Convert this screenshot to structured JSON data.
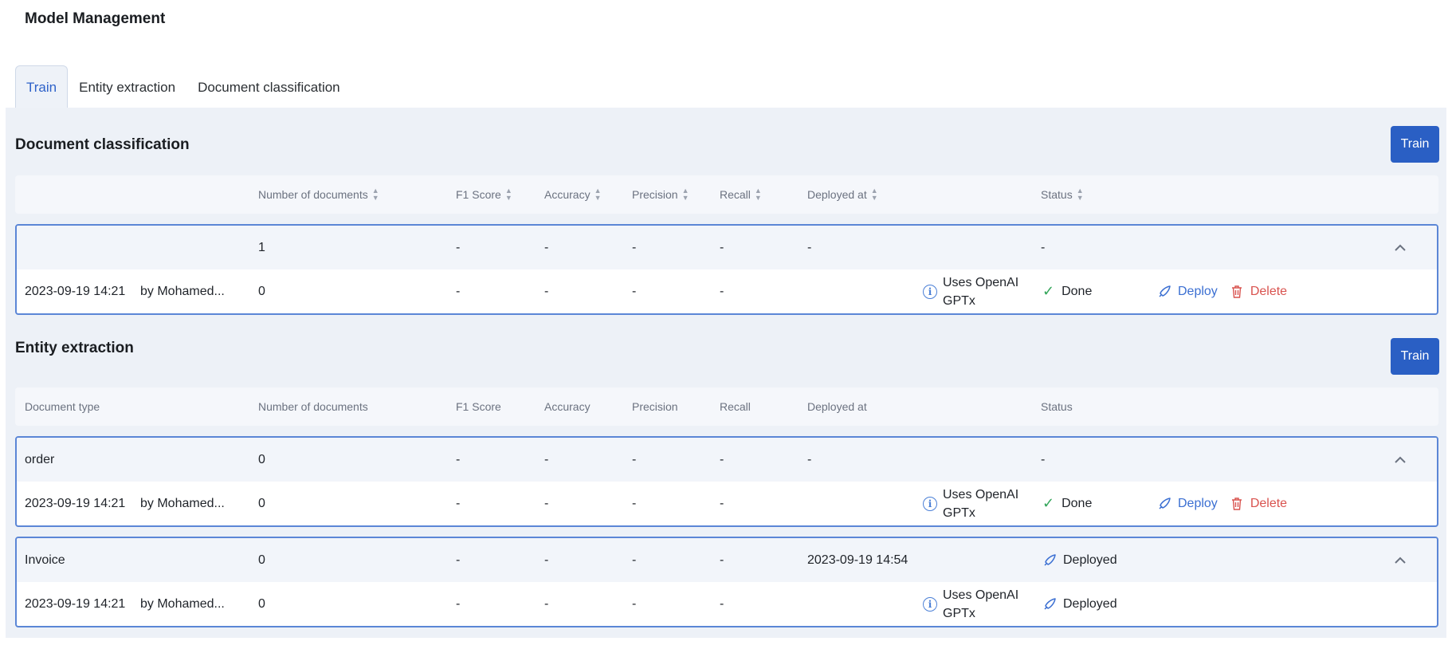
{
  "page": {
    "title": "Model Management"
  },
  "tabs": [
    {
      "label": "Train",
      "active": true
    },
    {
      "label": "Entity extraction",
      "active": false
    },
    {
      "label": "Document classification",
      "active": false
    }
  ],
  "doc_class": {
    "title": "Document classification",
    "train_label": "Train",
    "headers": {
      "doc_type": "",
      "num_docs": "Number of documents",
      "f1": "F1 Score",
      "accuracy": "Accuracy",
      "precision": "Precision",
      "recall": "Recall",
      "deployed_at": "Deployed at",
      "status": "Status"
    },
    "groups": [
      {
        "summary": {
          "doc_type": "",
          "num_docs": "1",
          "f1": "-",
          "accuracy": "-",
          "precision": "-",
          "recall": "-",
          "deployed_at": "-",
          "status": "-"
        },
        "version": {
          "date": "2023-09-19 14:21",
          "by": "by Mohamed...",
          "num_docs": "0",
          "f1": "-",
          "accuracy": "-",
          "precision": "-",
          "recall": "-",
          "info_line1": "Uses OpenAI",
          "info_line2": "GPTx",
          "status": "Done",
          "deploy_label": "Deploy",
          "delete_label": "Delete"
        }
      }
    ]
  },
  "entity": {
    "title": "Entity extraction",
    "train_label": "Train",
    "headers": {
      "doc_type": "Document type",
      "num_docs": "Number of documents",
      "f1": "F1 Score",
      "accuracy": "Accuracy",
      "precision": "Precision",
      "recall": "Recall",
      "deployed_at": "Deployed at",
      "status": "Status"
    },
    "groups": [
      {
        "summary": {
          "doc_type": "order",
          "num_docs": "0",
          "f1": "-",
          "accuracy": "-",
          "precision": "-",
          "recall": "-",
          "deployed_at": "-",
          "status": "-"
        },
        "version": {
          "date": "2023-09-19 14:21",
          "by": "by Mohamed...",
          "num_docs": "0",
          "f1": "-",
          "accuracy": "-",
          "precision": "-",
          "recall": "-",
          "info_line1": "Uses OpenAI",
          "info_line2": "GPTx",
          "status": "Done",
          "deploy_label": "Deploy",
          "delete_label": "Delete"
        }
      },
      {
        "summary": {
          "doc_type": "Invoice",
          "num_docs": "0",
          "f1": "-",
          "accuracy": "-",
          "precision": "-",
          "recall": "-",
          "deployed_at": "2023-09-19 14:54",
          "status": "Deployed"
        },
        "version": {
          "date": "2023-09-19 14:21",
          "by": "by Mohamed...",
          "num_docs": "0",
          "f1": "-",
          "accuracy": "-",
          "precision": "-",
          "recall": "-",
          "info_line1": "Uses OpenAI",
          "info_line2": "GPTx",
          "status": "Deployed"
        }
      }
    ]
  },
  "icons": {
    "sort": "sort-icon",
    "chevron": "chevron-up-icon",
    "info": "info-icon",
    "check": "check-icon",
    "rocket": "rocket-icon",
    "trash": "trash-icon"
  },
  "colors": {
    "accent": "#2a5fc4",
    "success": "#33a55a",
    "danger": "#d9534f",
    "panel": "#edf1f7"
  }
}
